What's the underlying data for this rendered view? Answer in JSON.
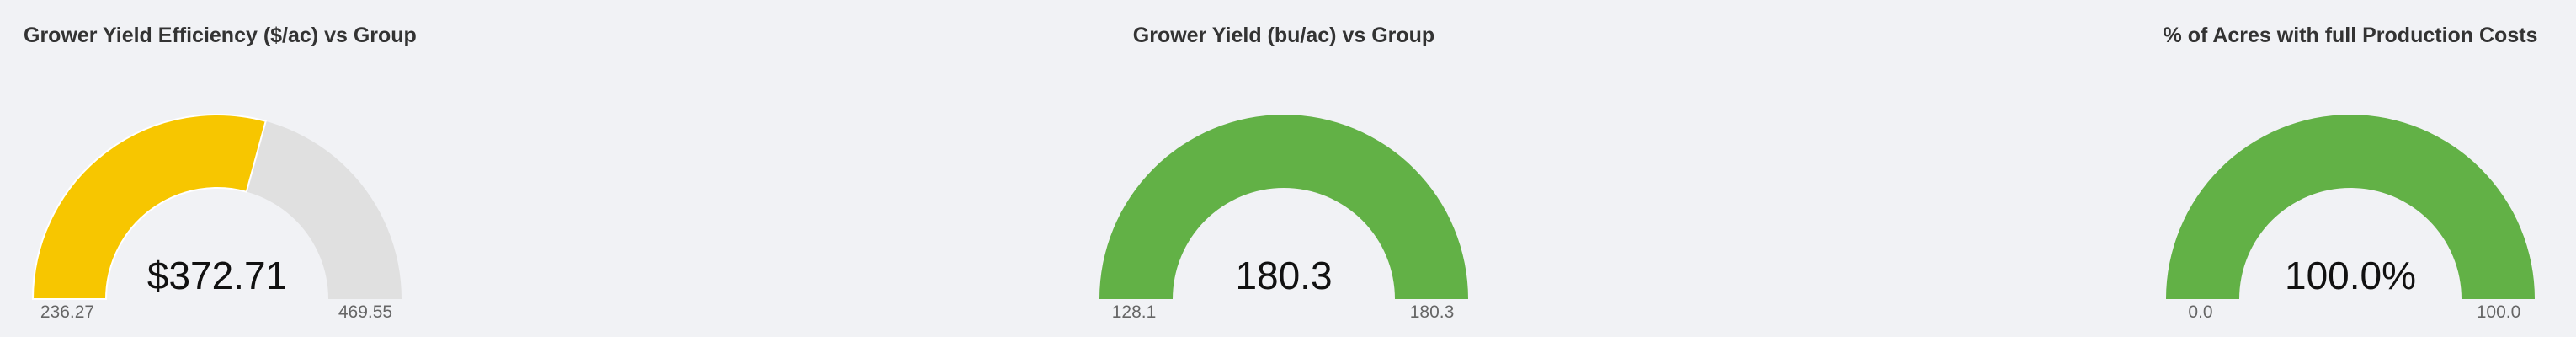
{
  "chart_data": [
    {
      "type": "gauge",
      "title": "Grower Yield Efficiency ($/ac) vs Group",
      "min": 236.27,
      "max": 469.55,
      "value": 372.71,
      "value_label": "$372.71",
      "min_label": "236.27",
      "max_label": "469.55",
      "fill_color": "#f7c600",
      "track_color": "#e0e0e0"
    },
    {
      "type": "gauge",
      "title": "Grower Yield (bu/ac) vs Group",
      "min": 128.1,
      "max": 180.3,
      "value": 180.3,
      "value_label": "180.3",
      "min_label": "128.1",
      "max_label": "180.3",
      "fill_color": "#62b146",
      "track_color": "#e0e0e0"
    },
    {
      "type": "gauge",
      "title": "% of Acres with full Production Costs",
      "min": 0.0,
      "max": 100.0,
      "value": 100.0,
      "value_label": "100.0%",
      "min_label": "0.0",
      "max_label": "100.0",
      "fill_color": "#62b146",
      "track_color": "#e0e0e0"
    }
  ]
}
